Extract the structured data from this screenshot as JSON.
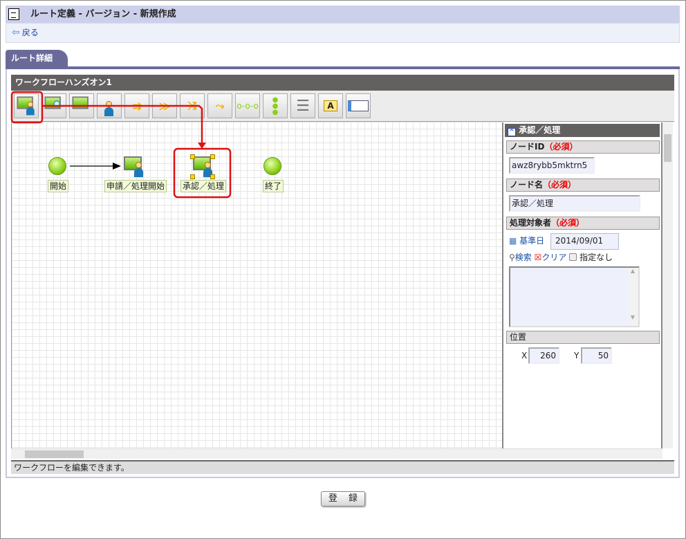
{
  "header": {
    "title": "ルート定義 - バージョン - 新規作成",
    "back_label": "戻る"
  },
  "tab": {
    "label": "ルート詳細"
  },
  "workflow": {
    "name": "ワークフローハンズオン1",
    "status": "ワークフローを編集できます。"
  },
  "toolbar": {
    "tools": [
      "user-process-node-icon",
      "user-search-node-icon",
      "system-node-icon",
      "user-node-icon",
      "branch-merge-icon",
      "merge-icon",
      "branch-icon",
      "join-icon",
      "sequence-icon",
      "parallel-icon",
      "database-icon",
      "text-annotation-icon",
      "swimlane-icon"
    ]
  },
  "nodes": [
    {
      "label": "開始"
    },
    {
      "label": "申請／処理開始"
    },
    {
      "label": "承認／処理"
    },
    {
      "label": "終了"
    }
  ],
  "properties": {
    "title": "承認／処理",
    "node_id_label": "ノードID",
    "required": "（必須）",
    "node_id": "awz8rybb5mktrn5",
    "node_name_label": "ノード名",
    "node_name": "承認／処理",
    "target_label": "処理対象者",
    "base_date_label": "基準日",
    "base_date": "2014/09/01",
    "search_label": "検索",
    "clear_label": "クリア",
    "unspecified_label": "指定なし",
    "position_label": "位置",
    "x_label": "X",
    "x": "260",
    "y_label": "Y",
    "y": "50"
  },
  "footer": {
    "register_label": "登 録"
  },
  "colors": {
    "highlight": "#dd1111",
    "accent": "#6a6a9a"
  }
}
